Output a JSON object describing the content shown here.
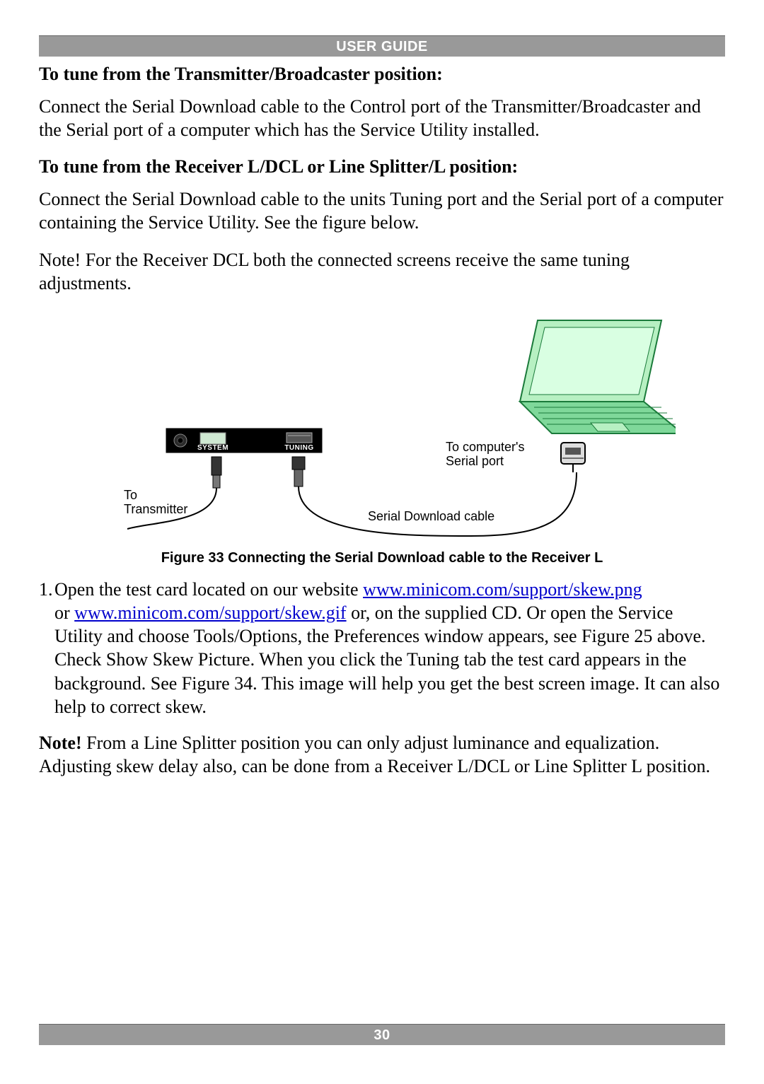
{
  "header": {
    "title": "USER GUIDE"
  },
  "footer": {
    "page": "30"
  },
  "section1": {
    "heading": "To tune from the Transmitter/Broadcaster position",
    "colon": ":",
    "para": "Connect the Serial Download cable to the Control port of the Transmitter/Broadcaster and the Serial port of a computer which has the Service Utility installed."
  },
  "section2": {
    "heading": "To tune from the Receiver L/DCL or Line Splitter/L position:",
    "para": "Connect the Serial Download cable to the units Tuning port and the Serial port of a computer containing the Service Utility. See the figure below.",
    "note": "Note! For the Receiver DCL both the connected screens receive the same tuning adjustments."
  },
  "figure": {
    "caption": "Figure 33 Connecting the Serial Download cable to the Receiver L",
    "labels": {
      "to_transmitter": "To\nTransmitter",
      "serial_cable": "Serial Download cable",
      "to_computer": "To computer's\nSerial port",
      "system": "SYSTEM",
      "tuning": "TUNING"
    }
  },
  "step1": {
    "num": "1.",
    "pre": "Open the test card located on our website ",
    "link1": "www.minicom.com/support/skew.png",
    "mid1": " or ",
    "link2": "www.minicom.com/support/skew.gif",
    "post": " or, on the supplied CD. Or open the Service Utility and choose Tools/Options, the Preferences window appears, see Figure 25 above. Check Show Skew Picture. When you click the Tuning tab the test card appears in the background. See Figure 34. This image will help you get the best screen image. It can also help to correct skew."
  },
  "note2": {
    "lead": "Note!",
    "body": " From a Line Splitter position you can only adjust luminance and equalization. Adjusting skew delay also, can be done from a Receiver L/DCL or Line Splitter L position."
  }
}
